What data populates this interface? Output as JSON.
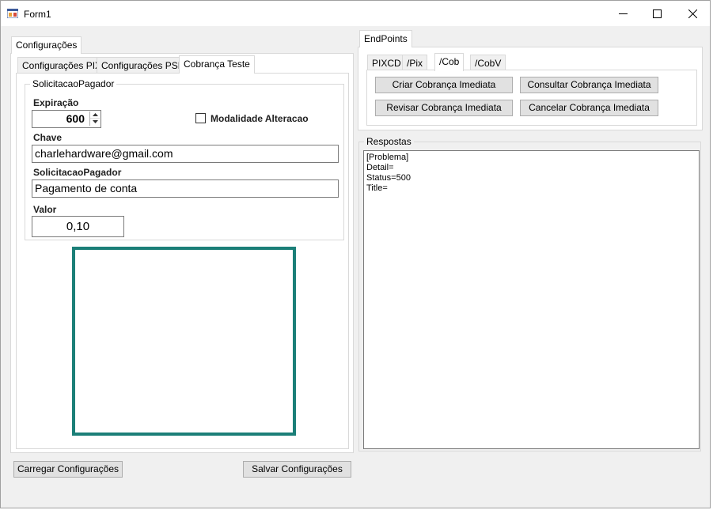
{
  "window": {
    "title": "Form1"
  },
  "left_tabs": {
    "main_tab": "Configurações"
  },
  "sub_tabs": [
    "Configurações PIX",
    "Configurações PSP",
    "Cobrança Teste"
  ],
  "group": {
    "legend": "SolicitacaoPagador",
    "expiracao_label": "Expiração",
    "expiracao_value": "600",
    "modalidade_label": "Modalidade Alteracao",
    "chave_label": "Chave",
    "chave_value": "charlehardware@gmail.com",
    "solicitacao_label": "SolicitacaoPagador",
    "solicitacao_value": "Pagamento de conta",
    "valor_label": "Valor",
    "valor_value": "0,10"
  },
  "bottom_buttons": {
    "load": "Carregar Configurações",
    "save": "Salvar Configurações"
  },
  "endpoints": {
    "tab": "EndPoints",
    "subtabs": [
      "PIXCD",
      "/Pix",
      "/Cob",
      "/CobV"
    ],
    "buttons": {
      "criar": "Criar Cobrança Imediata",
      "consultar": "Consultar Cobrança Imediata",
      "revisar": "Revisar Cobrança Imediata",
      "cancelar": "Cancelar Cobrança Imediata"
    }
  },
  "respostas": {
    "legend": "Respostas",
    "content": "[Problema]\nDetail=\nStatus=500\nTitle="
  }
}
